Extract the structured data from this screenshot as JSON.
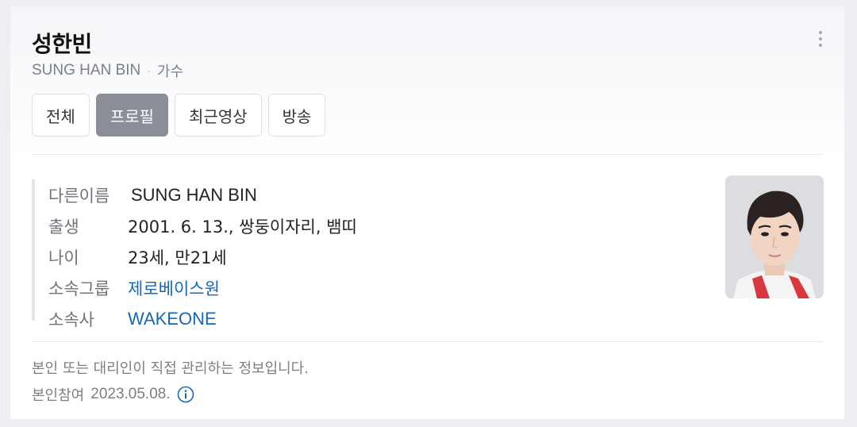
{
  "profile": {
    "name": "성한빈",
    "english_name": "SUNG HAN BIN",
    "separator": "·",
    "occupation": "가수"
  },
  "menu": {
    "icon": "more-vertical-icon"
  },
  "tabs": [
    {
      "label": "전체",
      "active": false
    },
    {
      "label": "프로필",
      "active": true
    },
    {
      "label": "최근영상",
      "active": false
    },
    {
      "label": "방송",
      "active": false
    }
  ],
  "info": [
    {
      "label": "다른이름",
      "value": "SUNG HAN BIN",
      "link": false
    },
    {
      "label": "출생",
      "value": "2001. 6. 13., 쌍둥이자리, 뱀띠",
      "link": false
    },
    {
      "label": "나이",
      "value": "23세, 만21세",
      "link": false
    },
    {
      "label": "소속그룹",
      "value": "제로베이스원",
      "link": true
    },
    {
      "label": "소속사",
      "value": "WAKEONE",
      "link": true
    }
  ],
  "footer": {
    "notice": "본인 또는 대리인이 직접 관리하는 정보입니다.",
    "participation_label": "본인참여",
    "participation_date": "2023.05.08.",
    "info_icon": "info-circle-icon"
  },
  "colors": {
    "active_tab": "#8a8e97",
    "link": "#1667b8",
    "muted_text": "#7b7f86"
  }
}
